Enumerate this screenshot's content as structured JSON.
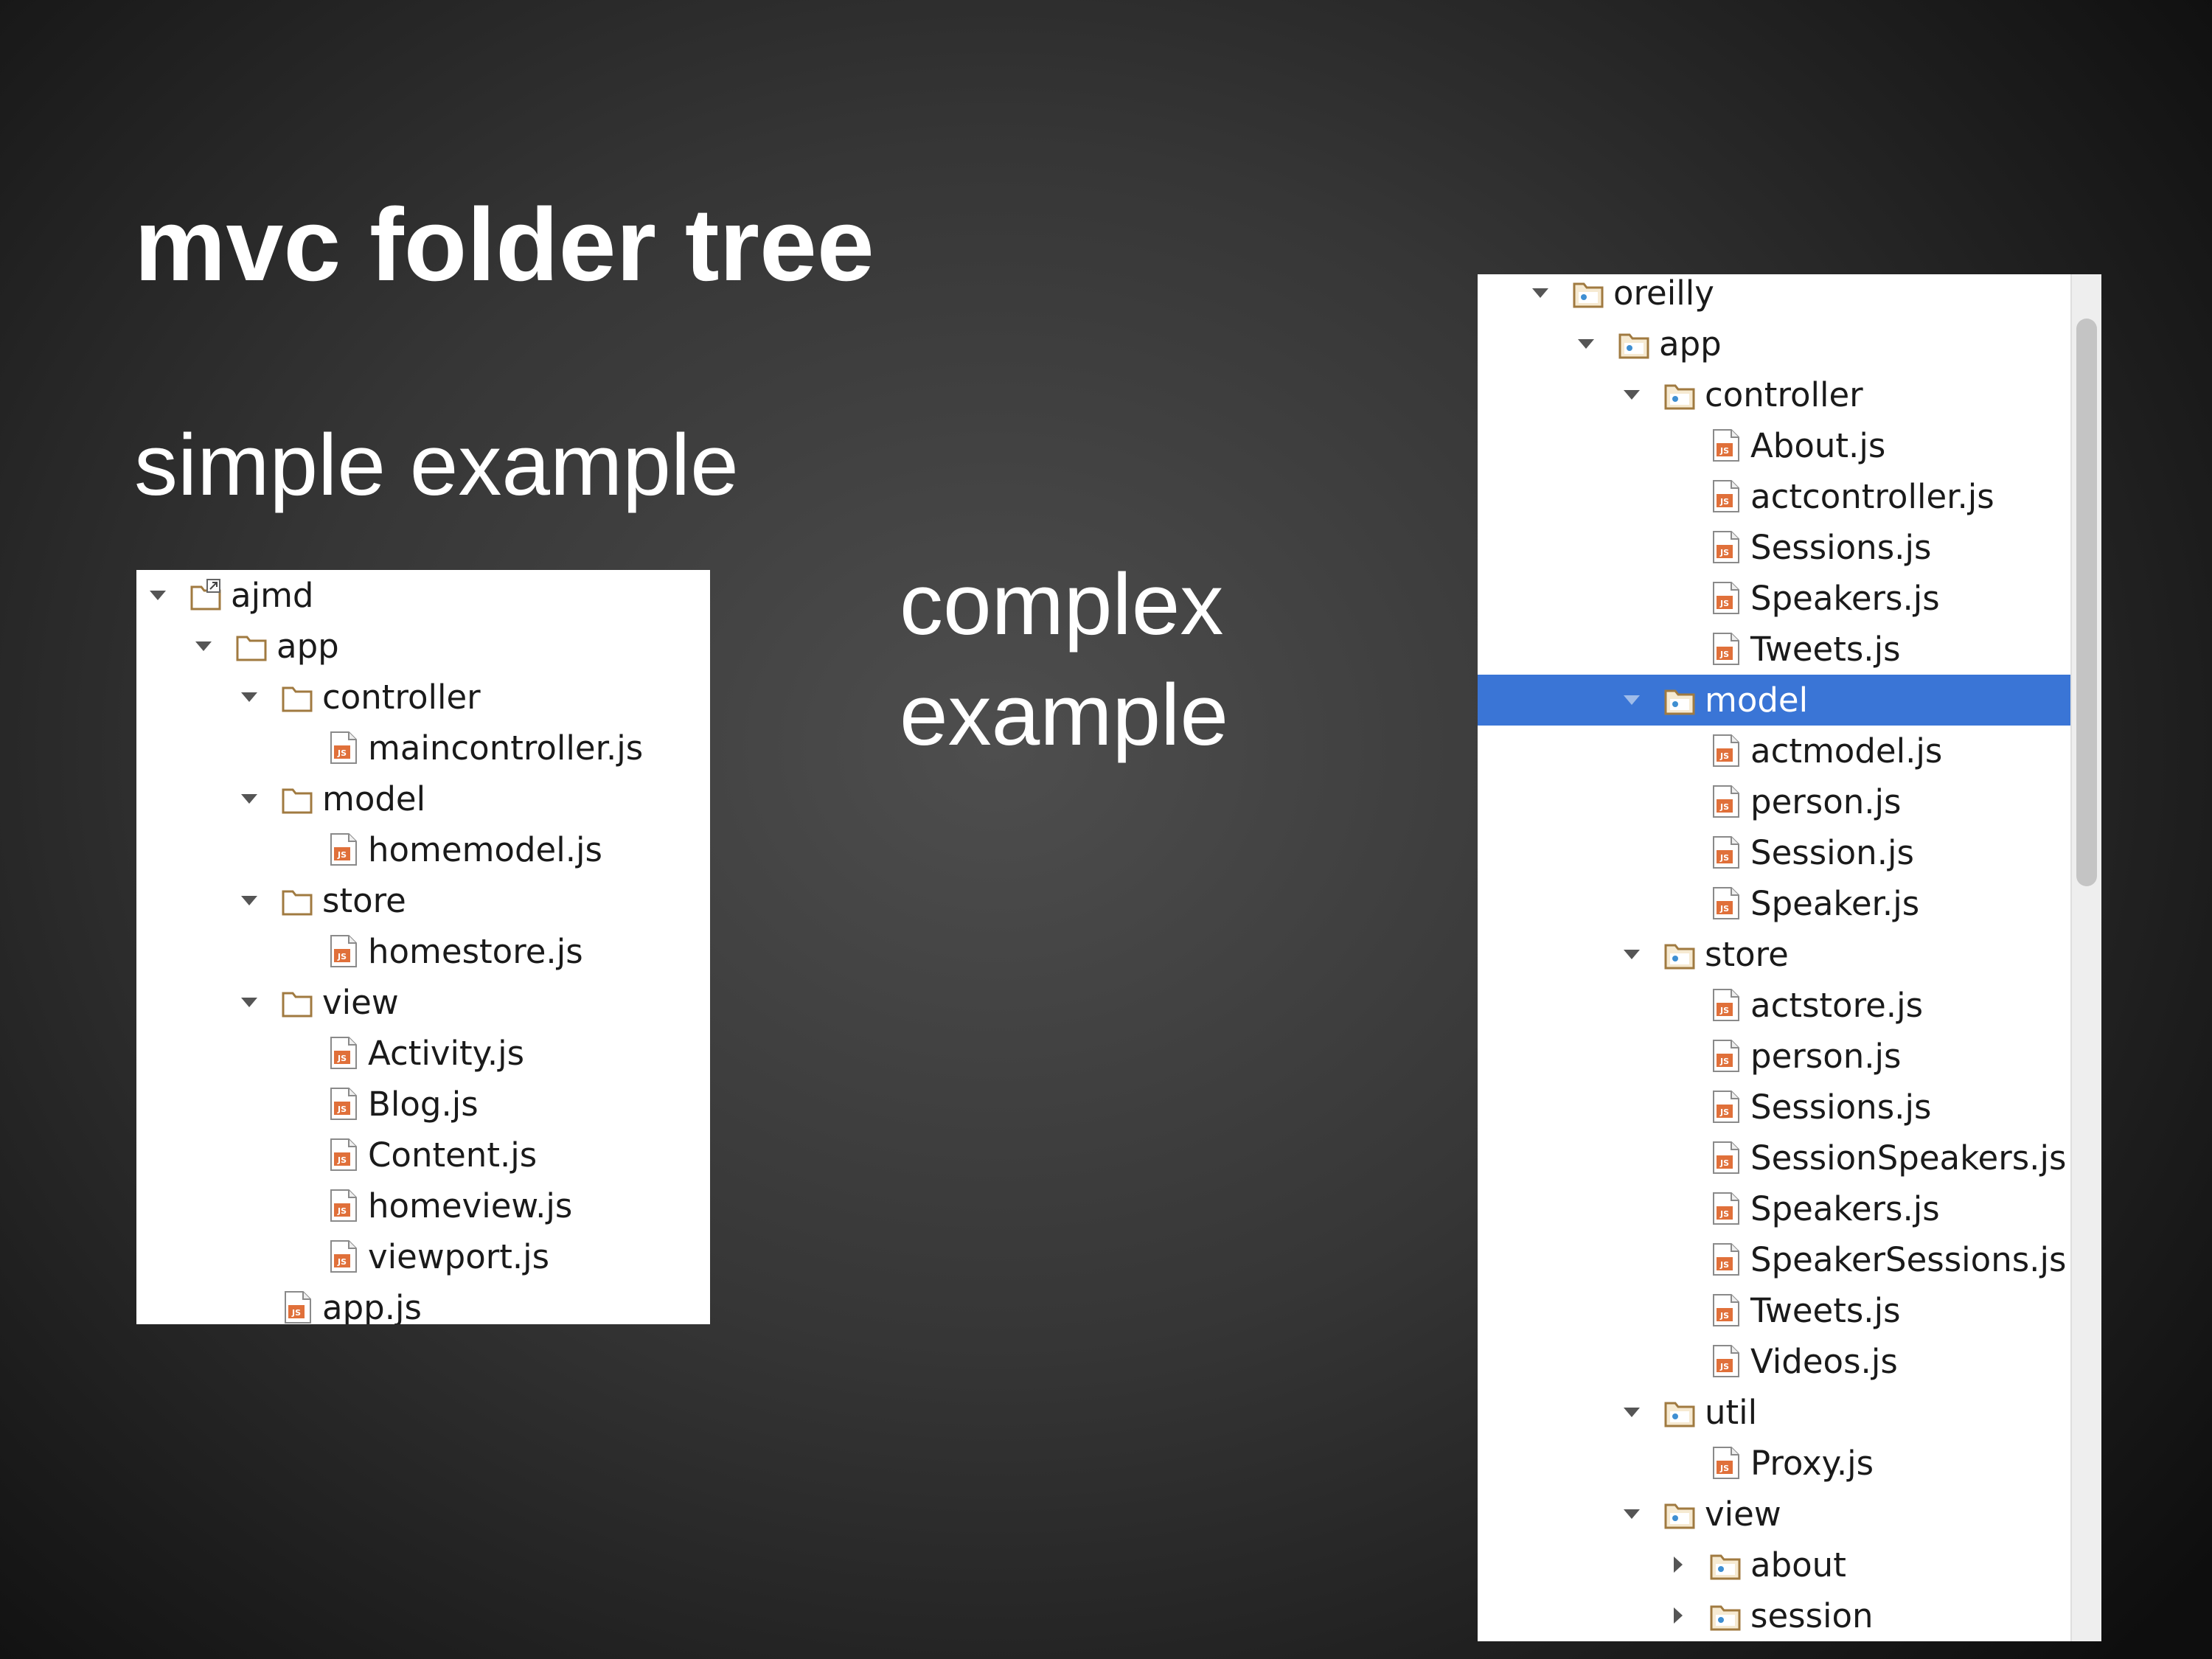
{
  "slide": {
    "title": "mvc folder tree",
    "simple_label": "simple example",
    "complex_label_line1": "complex",
    "complex_label_line2": "example"
  },
  "simple_tree": [
    {
      "label": "ajmd",
      "depth": 0,
      "kind": "project",
      "expanded": true,
      "icon": "project-folder-icon"
    },
    {
      "label": "app",
      "depth": 1,
      "kind": "folder",
      "expanded": true,
      "icon": "folder-icon"
    },
    {
      "label": "controller",
      "depth": 2,
      "kind": "folder",
      "expanded": true,
      "icon": "folder-icon"
    },
    {
      "label": "maincontroller.js",
      "depth": 3,
      "kind": "file",
      "icon": "js-file-icon"
    },
    {
      "label": "model",
      "depth": 2,
      "kind": "folder",
      "expanded": true,
      "icon": "folder-icon"
    },
    {
      "label": "homemodel.js",
      "depth": 3,
      "kind": "file",
      "icon": "js-file-icon"
    },
    {
      "label": "store",
      "depth": 2,
      "kind": "folder",
      "expanded": true,
      "icon": "folder-icon"
    },
    {
      "label": "homestore.js",
      "depth": 3,
      "kind": "file",
      "icon": "js-file-icon"
    },
    {
      "label": "view",
      "depth": 2,
      "kind": "folder",
      "expanded": true,
      "icon": "folder-icon"
    },
    {
      "label": "Activity.js",
      "depth": 3,
      "kind": "file",
      "icon": "js-file-icon"
    },
    {
      "label": "Blog.js",
      "depth": 3,
      "kind": "file",
      "icon": "js-file-icon"
    },
    {
      "label": "Content.js",
      "depth": 3,
      "kind": "file",
      "icon": "js-file-icon"
    },
    {
      "label": "homeview.js",
      "depth": 3,
      "kind": "file",
      "icon": "js-file-icon"
    },
    {
      "label": "viewport.js",
      "depth": 3,
      "kind": "file",
      "icon": "js-file-icon"
    },
    {
      "label": "app.js",
      "depth": 2,
      "kind": "file",
      "icon": "js-file-icon"
    }
  ],
  "complex_tree": [
    {
      "label": "oreilly",
      "depth": 0,
      "kind": "package",
      "expanded": true,
      "icon": "package-folder-icon"
    },
    {
      "label": "app",
      "depth": 1,
      "kind": "package",
      "expanded": true,
      "icon": "package-folder-icon"
    },
    {
      "label": "controller",
      "depth": 2,
      "kind": "package",
      "expanded": true,
      "icon": "package-folder-icon"
    },
    {
      "label": "About.js",
      "depth": 3,
      "kind": "file",
      "icon": "js-file-icon"
    },
    {
      "label": "actcontroller.js",
      "depth": 3,
      "kind": "file",
      "icon": "js-file-icon"
    },
    {
      "label": "Sessions.js",
      "depth": 3,
      "kind": "file",
      "icon": "js-file-icon"
    },
    {
      "label": "Speakers.js",
      "depth": 3,
      "kind": "file",
      "icon": "js-file-icon"
    },
    {
      "label": "Tweets.js",
      "depth": 3,
      "kind": "file",
      "icon": "js-file-icon"
    },
    {
      "label": "model",
      "depth": 2,
      "kind": "package",
      "expanded": true,
      "selected": true,
      "icon": "package-folder-icon"
    },
    {
      "label": "actmodel.js",
      "depth": 3,
      "kind": "file",
      "icon": "js-file-icon"
    },
    {
      "label": "person.js",
      "depth": 3,
      "kind": "file",
      "icon": "js-file-icon"
    },
    {
      "label": "Session.js",
      "depth": 3,
      "kind": "file",
      "icon": "js-file-icon"
    },
    {
      "label": "Speaker.js",
      "depth": 3,
      "kind": "file",
      "icon": "js-file-icon"
    },
    {
      "label": "store",
      "depth": 2,
      "kind": "package",
      "expanded": true,
      "icon": "package-folder-icon"
    },
    {
      "label": "actstore.js",
      "depth": 3,
      "kind": "file",
      "icon": "js-file-icon"
    },
    {
      "label": "person.js",
      "depth": 3,
      "kind": "file",
      "icon": "js-file-icon"
    },
    {
      "label": "Sessions.js",
      "depth": 3,
      "kind": "file",
      "icon": "js-file-icon"
    },
    {
      "label": "SessionSpeakers.js",
      "depth": 3,
      "kind": "file",
      "icon": "js-file-icon"
    },
    {
      "label": "Speakers.js",
      "depth": 3,
      "kind": "file",
      "icon": "js-file-icon"
    },
    {
      "label": "SpeakerSessions.js",
      "depth": 3,
      "kind": "file",
      "icon": "js-file-icon"
    },
    {
      "label": "Tweets.js",
      "depth": 3,
      "kind": "file",
      "icon": "js-file-icon"
    },
    {
      "label": "Videos.js",
      "depth": 3,
      "kind": "file",
      "icon": "js-file-icon"
    },
    {
      "label": "util",
      "depth": 2,
      "kind": "package",
      "expanded": true,
      "icon": "package-folder-icon"
    },
    {
      "label": "Proxy.js",
      "depth": 3,
      "kind": "file",
      "icon": "js-file-icon"
    },
    {
      "label": "view",
      "depth": 2,
      "kind": "package",
      "expanded": true,
      "icon": "package-folder-icon"
    },
    {
      "label": "about",
      "depth": 3,
      "kind": "package",
      "expanded": false,
      "icon": "package-folder-icon"
    },
    {
      "label": "session",
      "depth": 3,
      "kind": "package",
      "expanded": false,
      "icon": "package-folder-icon"
    }
  ],
  "colors": {
    "selection": "#3a75d6",
    "folder_outline": "#a07a40",
    "folder_fill": "#f6ead2",
    "js_badge": "#e0703a",
    "twisty": "#555555"
  }
}
